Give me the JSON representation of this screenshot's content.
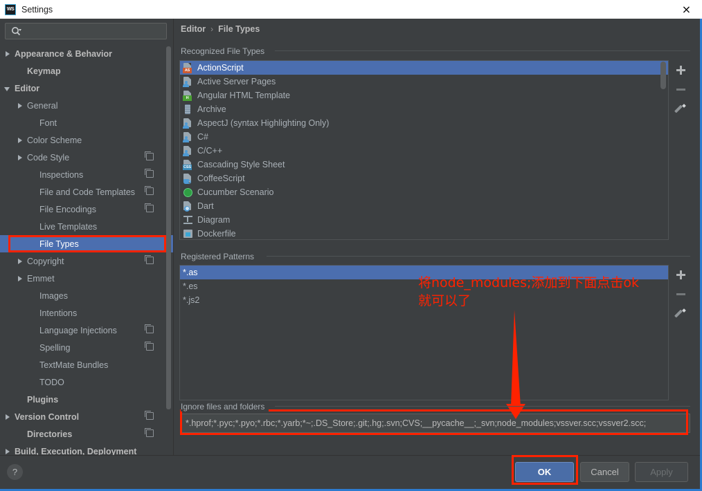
{
  "window": {
    "title": "Settings",
    "logo_text": "WS",
    "close_icon": "×"
  },
  "sidebar": {
    "search_placeholder": "",
    "search_value": "",
    "search_icon": "search-icon",
    "items": [
      {
        "label": "Appearance & Behavior",
        "indent": 0,
        "twisty": "right",
        "bold": true,
        "badge": false,
        "selected": false
      },
      {
        "label": "Keymap",
        "indent": 1,
        "twisty": "none",
        "bold": true,
        "badge": false,
        "selected": false
      },
      {
        "label": "Editor",
        "indent": 0,
        "twisty": "down",
        "bold": true,
        "badge": false,
        "selected": false
      },
      {
        "label": "General",
        "indent": 1,
        "twisty": "right",
        "bold": false,
        "badge": false,
        "selected": false
      },
      {
        "label": "Font",
        "indent": 2,
        "twisty": "none",
        "bold": false,
        "badge": false,
        "selected": false
      },
      {
        "label": "Color Scheme",
        "indent": 1,
        "twisty": "right",
        "bold": false,
        "badge": false,
        "selected": false
      },
      {
        "label": "Code Style",
        "indent": 1,
        "twisty": "right",
        "bold": false,
        "badge": true,
        "selected": false
      },
      {
        "label": "Inspections",
        "indent": 2,
        "twisty": "none",
        "bold": false,
        "badge": true,
        "selected": false
      },
      {
        "label": "File and Code Templates",
        "indent": 2,
        "twisty": "none",
        "bold": false,
        "badge": true,
        "selected": false
      },
      {
        "label": "File Encodings",
        "indent": 2,
        "twisty": "none",
        "bold": false,
        "badge": true,
        "selected": false
      },
      {
        "label": "Live Templates",
        "indent": 2,
        "twisty": "none",
        "bold": false,
        "badge": false,
        "selected": false
      },
      {
        "label": "File Types",
        "indent": 2,
        "twisty": "none",
        "bold": false,
        "badge": false,
        "selected": true
      },
      {
        "label": "Copyright",
        "indent": 1,
        "twisty": "right",
        "bold": false,
        "badge": true,
        "selected": false
      },
      {
        "label": "Emmet",
        "indent": 1,
        "twisty": "right",
        "bold": false,
        "badge": false,
        "selected": false
      },
      {
        "label": "Images",
        "indent": 2,
        "twisty": "none",
        "bold": false,
        "badge": false,
        "selected": false
      },
      {
        "label": "Intentions",
        "indent": 2,
        "twisty": "none",
        "bold": false,
        "badge": false,
        "selected": false
      },
      {
        "label": "Language Injections",
        "indent": 2,
        "twisty": "none",
        "bold": false,
        "badge": true,
        "selected": false
      },
      {
        "label": "Spelling",
        "indent": 2,
        "twisty": "none",
        "bold": false,
        "badge": true,
        "selected": false
      },
      {
        "label": "TextMate Bundles",
        "indent": 2,
        "twisty": "none",
        "bold": false,
        "badge": false,
        "selected": false
      },
      {
        "label": "TODO",
        "indent": 2,
        "twisty": "none",
        "bold": false,
        "badge": false,
        "selected": false
      },
      {
        "label": "Plugins",
        "indent": 1,
        "twisty": "none",
        "bold": true,
        "badge": false,
        "selected": false
      },
      {
        "label": "Version Control",
        "indent": 0,
        "twisty": "right",
        "bold": true,
        "badge": true,
        "selected": false
      },
      {
        "label": "Directories",
        "indent": 1,
        "twisty": "none",
        "bold": true,
        "badge": true,
        "selected": false
      },
      {
        "label": "Build, Execution, Deployment",
        "indent": 0,
        "twisty": "right",
        "bold": true,
        "badge": false,
        "selected": false
      }
    ]
  },
  "content": {
    "breadcrumb": {
      "parent": "Editor",
      "separator": "›",
      "current": "File Types"
    },
    "recognized": {
      "label": "Recognized File Types",
      "items": [
        {
          "name": "ActionScript",
          "icon": "badge",
          "badge_text": "AS",
          "badge_color": "#cc5c33",
          "selected": true
        },
        {
          "name": "Active Server Pages",
          "icon": "person",
          "selected": false
        },
        {
          "name": "Angular HTML Template",
          "icon": "badge",
          "badge_text": "H",
          "badge_color": "#4aa033",
          "selected": false
        },
        {
          "name": "Archive",
          "icon": "zip",
          "selected": false
        },
        {
          "name": "AspectJ (syntax Highlighting Only)",
          "icon": "person",
          "selected": false
        },
        {
          "name": "C#",
          "icon": "person",
          "selected": false
        },
        {
          "name": "C/C++",
          "icon": "person",
          "selected": false
        },
        {
          "name": "Cascading Style Sheet",
          "icon": "badge",
          "badge_text": "CSS",
          "badge_color": "#3a8ab8",
          "selected": false
        },
        {
          "name": "CoffeeScript",
          "icon": "cup",
          "selected": false
        },
        {
          "name": "Cucumber Scenario",
          "icon": "circle",
          "selected": false
        },
        {
          "name": "Dart",
          "icon": "dart",
          "selected": false
        },
        {
          "name": "Diagram",
          "icon": "diagram",
          "selected": false
        },
        {
          "name": "Dockerfile",
          "icon": "dock",
          "selected": false
        }
      ],
      "toolbar": [
        {
          "icon": "plus-icon",
          "name": "add-file-type-button",
          "enabled": true
        },
        {
          "icon": "minus-icon",
          "name": "remove-file-type-button",
          "enabled": false
        },
        {
          "icon": "pencil-icon",
          "name": "edit-file-type-button",
          "enabled": true
        }
      ]
    },
    "patterns": {
      "label": "Registered Patterns",
      "items": [
        {
          "name": "*.as",
          "selected": true
        },
        {
          "name": "*.es",
          "selected": false
        },
        {
          "name": "*.js2",
          "selected": false
        }
      ],
      "toolbar": [
        {
          "icon": "plus-icon",
          "name": "add-pattern-button",
          "enabled": true
        },
        {
          "icon": "minus-icon",
          "name": "remove-pattern-button",
          "enabled": true
        },
        {
          "icon": "pencil-icon",
          "name": "edit-pattern-button",
          "enabled": true
        }
      ]
    },
    "ignore": {
      "label": "Ignore files and folders",
      "value": "*.hprof;*.pyc;*.pyo;*.rbc;*.yarb;*~;.DS_Store;.git;.hg;.svn;CVS;__pycache__;_svn;node_modules;vssver.scc;vssver2.scc;"
    }
  },
  "footer": {
    "help_icon": "?",
    "ok_label": "OK",
    "cancel_label": "Cancel",
    "apply_label": "Apply"
  },
  "annotations": {
    "note_line1": "将node_modules;添加到下面点击ok",
    "note_line2": "就可以了",
    "color": "#ff2200"
  }
}
